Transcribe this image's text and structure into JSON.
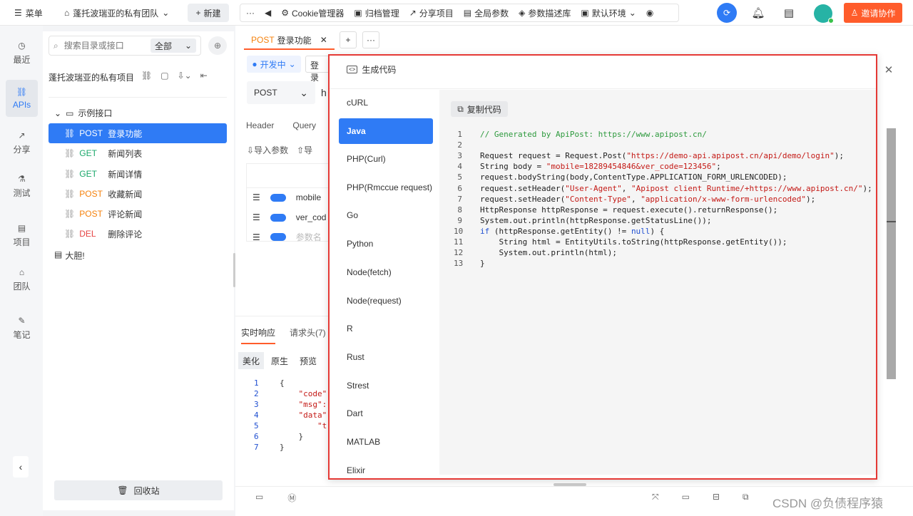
{
  "topbar": {
    "menu_label": "菜单",
    "team_name": "蓬托波瑞亚的私有团队",
    "new_label": "新建",
    "tools": [
      "Cookie管理器",
      "归档管理",
      "分享项目",
      "全局参数",
      "参数描述库",
      "默认环境"
    ],
    "invite_label": "邀请协作"
  },
  "rail": [
    {
      "label": "最近",
      "icon": "clock-icon"
    },
    {
      "label": "APIs",
      "icon": "link-icon"
    },
    {
      "label": "分享",
      "icon": "share-icon"
    },
    {
      "label": "测试",
      "icon": "test-icon"
    },
    {
      "label": "项目",
      "icon": "project-icon"
    },
    {
      "label": "团队",
      "icon": "team-icon"
    },
    {
      "label": "笔记",
      "icon": "note-icon"
    }
  ],
  "tree": {
    "search_placeholder": "搜索目录或接口",
    "filter_value": "全部",
    "project_name": "蓬托波瑞亚的私有项目",
    "folder": "示例接口",
    "items": [
      {
        "method": "POST",
        "name": "登录功能"
      },
      {
        "method": "GET",
        "name": "新闻列表"
      },
      {
        "method": "GET",
        "name": "新闻详情"
      },
      {
        "method": "POST",
        "name": "收藏新闻"
      },
      {
        "method": "POST",
        "name": "评论新闻"
      },
      {
        "method": "DEL",
        "name": "删除评论"
      }
    ],
    "doc": "大胆!",
    "recycle_label": "回收站"
  },
  "editor": {
    "tab_method": "POST",
    "tab_name": "登录功能",
    "status": "开发中",
    "method_select": "POST",
    "url_partial": "h",
    "crumb_partial": "登录",
    "subtabs": [
      "Header",
      "Query"
    ],
    "import_label": "导入参数",
    "import2_partial": "导",
    "params": [
      "mobile",
      "ver_cod",
      "参数名"
    ],
    "resp_tabs": [
      "实时响应",
      "请求头(7)"
    ],
    "view_tabs": [
      "美化",
      "原生",
      "预览"
    ],
    "resp_lines": [
      "{",
      "\"code\"",
      "\"msg\":",
      "\"data\"",
      "\"t",
      "}",
      "}"
    ]
  },
  "modal": {
    "title": "生成代码",
    "copy_label": "复制代码",
    "languages": [
      "cURL",
      "Java",
      "PHP(Curl)",
      "PHP(Rmccue request)",
      "Go",
      "Python",
      "Node(fetch)",
      "Node(request)",
      "R",
      "Rust",
      "Strest",
      "Dart",
      "MATLAB",
      "Elixir"
    ],
    "selected": "Java",
    "code": [
      "// Generated by ApiPost: https://www.apipost.cn/",
      "",
      "Request request = Request.Post(\"https://demo-api.apipost.cn/api/demo/login\");",
      "String body = \"mobile=18289454846&ver_code=123456\";",
      "request.bodyString(body,ContentType.APPLICATION_FORM_URLENCODED);",
      "request.setHeader(\"User-Agent\", \"Apipost client Runtime/+https://www.apipost.cn/\");",
      "request.setHeader(\"Content-Type\", \"application/x-www-form-urlencoded\");",
      "HttpResponse httpResponse = request.execute().returnResponse();",
      "System.out.println(httpResponse.getStatusLine());",
      "if (httpResponse.getEntity() != null) {",
      "    String html = EntityUtils.toString(httpResponse.getEntity());",
      "    System.out.println(html);",
      "}"
    ]
  },
  "watermark": "CSDN @负债程序猿"
}
